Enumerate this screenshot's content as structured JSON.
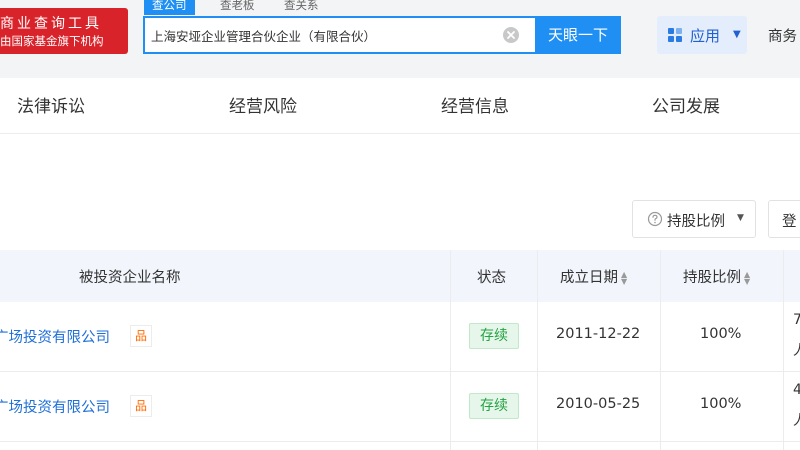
{
  "logo": {
    "line1": "商业查询工具",
    "line2": "由国家基金旗下机构"
  },
  "search": {
    "tabs": [
      "查公司",
      "查老板",
      "查关系"
    ],
    "value": "上海安垭企业管理合伙企业（有限合伙）",
    "button_label": "天眼一下"
  },
  "header": {
    "app_label": "应用",
    "business_label": "商务"
  },
  "nav": {
    "items": [
      "法律诉讼",
      "经营风险",
      "经营信息",
      "公司发展"
    ]
  },
  "filter": {
    "shareholding_label": "持股比例",
    "login_label": "登"
  },
  "table": {
    "headers": {
      "company": "被投资企业名称",
      "status": "状态",
      "date": "成立日期",
      "ratio": "持股比例"
    },
    "rows": [
      {
        "company": "广场投资有限公司",
        "badge": "品",
        "status": "存续",
        "date": "2011-12-22",
        "ratio": "100%",
        "cut_top": "7",
        "cut_bottom": "人"
      },
      {
        "company": "广场投资有限公司",
        "badge": "品",
        "status": "存续",
        "date": "2010-05-25",
        "ratio": "100%",
        "cut_top": "4",
        "cut_bottom": "人"
      }
    ]
  },
  "colors": {
    "brand_red": "#d9232b",
    "primary_blue": "#1f8ff3",
    "link_blue": "#1f6fd8",
    "status_green": "#25a244",
    "badge_orange": "#ff6a00"
  },
  "icons": {
    "clear": "clear-icon",
    "apps": "grid-icon",
    "help": "help-icon",
    "sort": "sort-icon"
  }
}
